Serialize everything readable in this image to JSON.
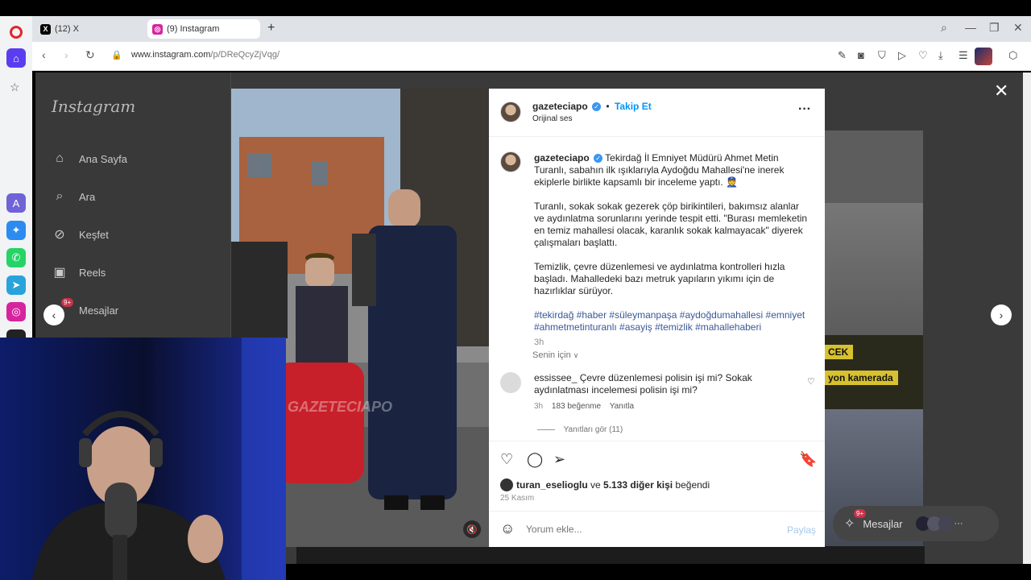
{
  "browser": {
    "tabs": [
      {
        "label": "(12) X"
      },
      {
        "label": "(9) Instagram"
      }
    ],
    "url_domain": "www.instagram.com",
    "url_path": "/p/DReQcyZjVqg/"
  },
  "instagram": {
    "logo": "Instagram",
    "nav": [
      {
        "label": "Ana Sayfa",
        "icon": "home-icon"
      },
      {
        "label": "Ara",
        "icon": "search-icon"
      },
      {
        "label": "Keşfet",
        "icon": "compass-icon"
      },
      {
        "label": "Reels",
        "icon": "reels-icon"
      },
      {
        "label": "Mesajlar",
        "icon": "messenger-icon"
      }
    ],
    "messages_badge": "9+"
  },
  "post": {
    "username": "gazeteciapo",
    "follow": "Takip Et",
    "dot": "•",
    "audio": "Orijinal ses",
    "watermark": "GAZETECIAPO",
    "caption_p1": "Tekirdağ İl Emniyet Müdürü Ahmet Metin Turanlı, sabahın ilk ışıklarıyla Aydoğdu Mahallesi'ne inerek ekiplerle birlikte kapsamlı bir inceleme yaptı. 👮",
    "caption_p2": "Turanlı, sokak sokak gezerek çöp birikintileri, bakımsız alanlar ve aydınlatma sorunlarını yerinde tespit etti. \"Burası memleketin en temiz mahallesi olacak, karanlık sokak kalmayacak\" diyerek çalışmaları başlattı.",
    "caption_p3": "Temizlik, çevre düzenlemesi ve aydınlatma kontrolleri hızla başladı. Mahalledeki bazı metruk yapıların yıkımı için de hazırlıklar sürüyor.",
    "hashtags": "#tekirdağ #haber #süleymanpaşa #aydoğdumahallesi #emniyet #ahmetmetinturanlı #asayiş #temizlik #mahallehaberi",
    "caption_time": "3h",
    "for_you": "Senin için",
    "comment": {
      "user": "essissee_",
      "text": "Çevre düzenlemesi polisin işi mi? Sokak aydınlatması incelemesi polisin işi mi?",
      "time": "3h",
      "likes": "183 beğenme",
      "reply": "Yanıtla",
      "view_replies": "Yanıtları gör (11)"
    },
    "liked_by_user": "turan_eselioglu",
    "liked_by_mid": " ve ",
    "liked_by_others": "5.133 diğer kişi",
    "liked_by_tail": " beğendi",
    "date": "25 Kasım",
    "comment_placeholder": "Yorum ekle...",
    "share_label": "Paylaş"
  },
  "background": {
    "label_1": "CEK",
    "label_2": "yon kamerada"
  },
  "chat": {
    "label": "Mesajlar",
    "badge": "9+",
    "more": "···"
  },
  "colors": {
    "link": "#385898",
    "verified": "#3897f0",
    "follow": "#0095f6",
    "badge": "#c8324a"
  }
}
